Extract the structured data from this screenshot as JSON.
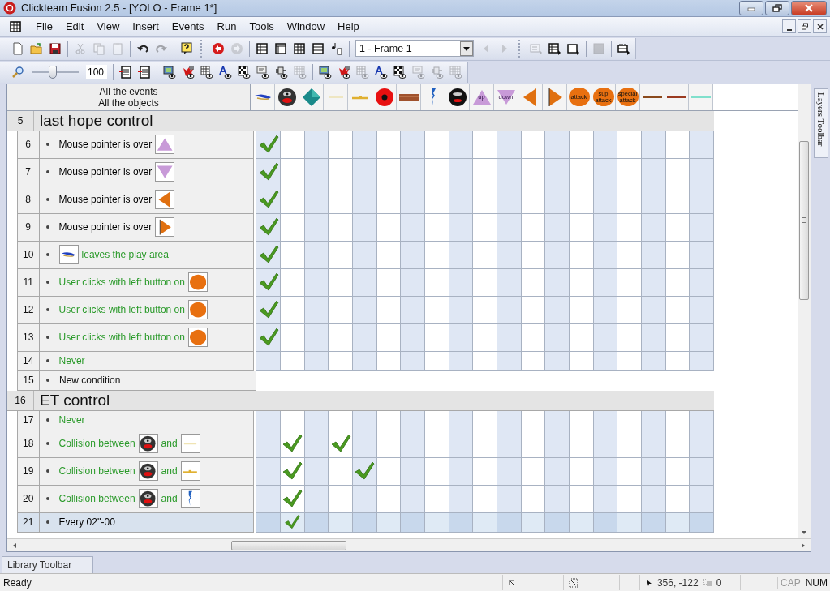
{
  "window": {
    "title": "Clickteam Fusion 2.5 - [YOLO - Frame 1*]"
  },
  "menu": [
    {
      "label": "File"
    },
    {
      "label": "Edit"
    },
    {
      "label": "View"
    },
    {
      "label": "Insert"
    },
    {
      "label": "Events"
    },
    {
      "label": "Run"
    },
    {
      "label": "Tools"
    },
    {
      "label": "Window"
    },
    {
      "label": "Help"
    }
  ],
  "toolbar": [
    {
      "kind": "new",
      "disabled": false
    },
    {
      "kind": "open",
      "disabled": false
    },
    {
      "kind": "save",
      "disabled": false
    },
    {
      "kind": "separator"
    },
    {
      "kind": "cut",
      "disabled": true
    },
    {
      "kind": "copy",
      "disabled": true
    },
    {
      "kind": "paste",
      "disabled": true
    },
    {
      "kind": "separator"
    },
    {
      "kind": "undo",
      "disabled": false
    },
    {
      "kind": "redo",
      "disabled": true
    },
    {
      "kind": "separator"
    },
    {
      "kind": "help",
      "disabled": false
    },
    {
      "kind": "grip"
    },
    {
      "kind": "back",
      "disabled": false
    },
    {
      "kind": "forward",
      "disabled": true
    },
    {
      "kind": "separator"
    },
    {
      "kind": "list",
      "disabled": false
    },
    {
      "kind": "window",
      "disabled": false
    },
    {
      "kind": "grid",
      "disabled": false
    },
    {
      "kind": "rows",
      "disabled": false
    },
    {
      "kind": "sound",
      "disabled": false
    },
    {
      "kind": "separator"
    },
    {
      "kind": "frame-select",
      "value": "1 - Frame 1"
    },
    {
      "kind": "prev",
      "disabled": true
    },
    {
      "kind": "next",
      "disabled": true
    },
    {
      "kind": "grip"
    },
    {
      "kind": "export-text",
      "disabled": true
    },
    {
      "kind": "export-list",
      "disabled": false
    },
    {
      "kind": "export-window",
      "disabled": false
    },
    {
      "kind": "separator"
    },
    {
      "kind": "stop",
      "disabled": true
    },
    {
      "kind": "separator"
    },
    {
      "kind": "storyboard",
      "disabled": false
    }
  ],
  "toolbar2": [
    {
      "kind": "zoom",
      "disabled": false
    },
    {
      "kind": "zoom-slider",
      "level": 0.45
    },
    {
      "kind": "zoom-field",
      "value": "100"
    },
    {
      "kind": "separator"
    },
    {
      "kind": "list-red",
      "disabled": false
    },
    {
      "kind": "list-red",
      "disabled": false
    },
    {
      "kind": "separator"
    },
    {
      "kind": "eye-screen",
      "disabled": false
    },
    {
      "kind": "eye-actor",
      "disabled": false
    },
    {
      "kind": "eye-pieces",
      "disabled": false
    },
    {
      "kind": "eye-text",
      "disabled": false
    },
    {
      "kind": "eye-checker",
      "disabled": false
    },
    {
      "kind": "eye-speech",
      "disabled": false
    },
    {
      "kind": "eye-plug",
      "disabled": false
    },
    {
      "kind": "eye-grid",
      "disabled": true
    },
    {
      "kind": "separator"
    },
    {
      "kind": "eye-screen",
      "disabled": false
    },
    {
      "kind": "eye-actor",
      "disabled": false
    },
    {
      "kind": "eye-pieces",
      "disabled": true
    },
    {
      "kind": "eye-text",
      "disabled": false
    },
    {
      "kind": "eye-checker",
      "disabled": false
    },
    {
      "kind": "eye-speech",
      "disabled": true
    },
    {
      "kind": "eye-plug",
      "disabled": true
    },
    {
      "kind": "eye-grid",
      "disabled": true
    }
  ],
  "editor": {
    "header_lines": [
      "All the events",
      "All the objects"
    ],
    "objects": [
      {
        "kind": "ship"
      },
      {
        "kind": "alien"
      },
      {
        "kind": "gem"
      },
      {
        "kind": "thin-line"
      },
      {
        "kind": "platform"
      },
      {
        "kind": "mine"
      },
      {
        "kind": "log"
      },
      {
        "kind": "bolt"
      },
      {
        "kind": "ufo"
      },
      {
        "kind": "arrow-up",
        "label": "up"
      },
      {
        "kind": "arrow-down",
        "label": "down"
      },
      {
        "kind": "arrow-left"
      },
      {
        "kind": "arrow-right"
      },
      {
        "kind": "button",
        "label": "attack"
      },
      {
        "kind": "button",
        "label": "sup attack"
      },
      {
        "kind": "button",
        "label": "special attack"
      },
      {
        "kind": "line",
        "color": "#8a4a1c"
      },
      {
        "kind": "line",
        "color": "#9a3a20"
      },
      {
        "kind": "line",
        "color": "#80e0cc"
      }
    ],
    "rows": [
      {
        "kind": "group",
        "num": "5",
        "title": "last hope control"
      },
      {
        "kind": "event",
        "num": "6",
        "color": "#000000",
        "selected": false,
        "parts": [
          {
            "kind": "text",
            "text": "Mouse pointer is over"
          },
          {
            "kind": "arrow-up"
          }
        ],
        "checks": [
          true,
          false,
          false,
          false,
          false,
          false,
          false,
          false,
          false,
          false,
          false,
          false,
          false,
          false,
          false,
          false,
          false,
          false,
          false
        ]
      },
      {
        "kind": "event",
        "num": "7",
        "color": "#000000",
        "selected": false,
        "parts": [
          {
            "kind": "text",
            "text": "Mouse pointer is over"
          },
          {
            "kind": "arrow-down"
          }
        ],
        "checks": [
          true,
          false,
          false,
          false,
          false,
          false,
          false,
          false,
          false,
          false,
          false,
          false,
          false,
          false,
          false,
          false,
          false,
          false,
          false
        ]
      },
      {
        "kind": "event",
        "num": "8",
        "color": "#000000",
        "selected": false,
        "parts": [
          {
            "kind": "text",
            "text": "Mouse pointer is over"
          },
          {
            "kind": "arrow-left"
          }
        ],
        "checks": [
          true,
          false,
          false,
          false,
          false,
          false,
          false,
          false,
          false,
          false,
          false,
          false,
          false,
          false,
          false,
          false,
          false,
          false,
          false
        ]
      },
      {
        "kind": "event",
        "num": "9",
        "color": "#000000",
        "selected": false,
        "parts": [
          {
            "kind": "text",
            "text": "Mouse pointer is over"
          },
          {
            "kind": "arrow-right"
          }
        ],
        "checks": [
          true,
          false,
          false,
          false,
          false,
          false,
          false,
          false,
          false,
          false,
          false,
          false,
          false,
          false,
          false,
          false,
          false,
          false,
          false
        ]
      },
      {
        "kind": "event",
        "num": "10",
        "color": "#2a9a2a",
        "selected": false,
        "parts": [
          {
            "kind": "ship"
          },
          {
            "kind": "text",
            "text": "leaves the play area"
          }
        ],
        "checks": [
          true,
          false,
          false,
          false,
          false,
          false,
          false,
          false,
          false,
          false,
          false,
          false,
          false,
          false,
          false,
          false,
          false,
          false,
          false
        ]
      },
      {
        "kind": "event",
        "num": "11",
        "color": "#2a9a2a",
        "selected": false,
        "parts": [
          {
            "kind": "text",
            "text": "User clicks with left button on"
          },
          {
            "kind": "button"
          }
        ],
        "checks": [
          true,
          false,
          false,
          false,
          false,
          false,
          false,
          false,
          false,
          false,
          false,
          false,
          false,
          false,
          false,
          false,
          false,
          false,
          false
        ]
      },
      {
        "kind": "event",
        "num": "12",
        "color": "#2a9a2a",
        "selected": false,
        "parts": [
          {
            "kind": "text",
            "text": "User clicks with left button on"
          },
          {
            "kind": "button"
          }
        ],
        "checks": [
          true,
          false,
          false,
          false,
          false,
          false,
          false,
          false,
          false,
          false,
          false,
          false,
          false,
          false,
          false,
          false,
          false,
          false,
          false
        ]
      },
      {
        "kind": "event",
        "num": "13",
        "color": "#2a9a2a",
        "selected": false,
        "parts": [
          {
            "kind": "text",
            "text": "User clicks with left button on"
          },
          {
            "kind": "button"
          }
        ],
        "checks": [
          true,
          false,
          false,
          false,
          false,
          false,
          false,
          false,
          false,
          false,
          false,
          false,
          false,
          false,
          false,
          false,
          false,
          false,
          false
        ]
      },
      {
        "kind": "event",
        "num": "14",
        "color": "#2a9a2a",
        "selected": false,
        "parts": [
          {
            "kind": "text",
            "text": "Never"
          }
        ],
        "checks": [
          false,
          false,
          false,
          false,
          false,
          false,
          false,
          false,
          false,
          false,
          false,
          false,
          false,
          false,
          false,
          false,
          false,
          false,
          false
        ]
      },
      {
        "kind": "new",
        "num": "15",
        "text": "New condition"
      },
      {
        "kind": "group",
        "num": "16",
        "title": "ET control"
      },
      {
        "kind": "event",
        "num": "17",
        "color": "#2a9a2a",
        "selected": false,
        "parts": [
          {
            "kind": "text",
            "text": "Never"
          }
        ],
        "checks": [
          false,
          false,
          false,
          false,
          false,
          false,
          false,
          false,
          false,
          false,
          false,
          false,
          false,
          false,
          false,
          false,
          false,
          false,
          false
        ]
      },
      {
        "kind": "event",
        "num": "18",
        "color": "#2a9a2a",
        "selected": false,
        "parts": [
          {
            "kind": "text",
            "text": "Collision between"
          },
          {
            "kind": "alien"
          },
          {
            "kind": "text",
            "text": "and"
          },
          {
            "kind": "thin-line"
          }
        ],
        "checks": [
          false,
          true,
          false,
          true,
          false,
          false,
          false,
          false,
          false,
          false,
          false,
          false,
          false,
          false,
          false,
          false,
          false,
          false,
          false
        ]
      },
      {
        "kind": "event",
        "num": "19",
        "color": "#2a9a2a",
        "selected": false,
        "parts": [
          {
            "kind": "text",
            "text": "Collision between"
          },
          {
            "kind": "alien"
          },
          {
            "kind": "text",
            "text": "and"
          },
          {
            "kind": "platform"
          }
        ],
        "checks": [
          false,
          true,
          false,
          false,
          true,
          false,
          false,
          false,
          false,
          false,
          false,
          false,
          false,
          false,
          false,
          false,
          false,
          false,
          false
        ]
      },
      {
        "kind": "event",
        "num": "20",
        "color": "#2a9a2a",
        "selected": false,
        "parts": [
          {
            "kind": "text",
            "text": "Collision between"
          },
          {
            "kind": "alien"
          },
          {
            "kind": "text",
            "text": "and"
          },
          {
            "kind": "bolt"
          }
        ],
        "checks": [
          false,
          true,
          false,
          false,
          false,
          false,
          false,
          false,
          false,
          false,
          false,
          false,
          false,
          false,
          false,
          false,
          false,
          false,
          false
        ]
      },
      {
        "kind": "event",
        "num": "21",
        "color": "#000000",
        "selected": true,
        "parts": [
          {
            "kind": "text",
            "text": "Every 02''-00"
          }
        ],
        "checks": [
          false,
          true,
          false,
          false,
          false,
          false,
          false,
          false,
          false,
          false,
          false,
          false,
          false,
          false,
          false,
          false,
          false,
          false,
          false
        ]
      }
    ]
  },
  "side_tab": {
    "label": "Layers Toolbar"
  },
  "bottom_tab": {
    "label": "Library Toolbar"
  },
  "status_bar": {
    "text": "Ready",
    "coords": "356, -122",
    "count": "0",
    "indicators": [
      {
        "label": "CAP",
        "on": false
      },
      {
        "label": "NUM",
        "on": true
      }
    ]
  }
}
